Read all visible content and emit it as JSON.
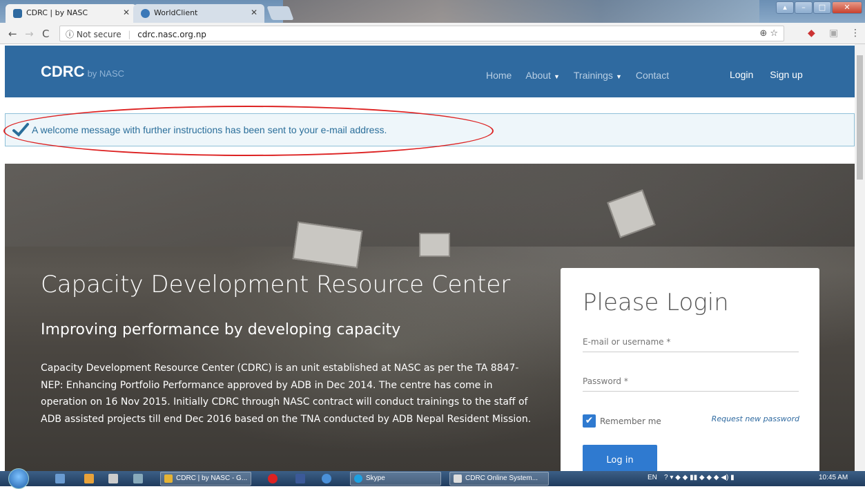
{
  "browser": {
    "tabs": [
      {
        "label": "CDRC | by NASC",
        "active": true
      },
      {
        "label": "WorldClient",
        "active": false
      }
    ],
    "security": "Not secure",
    "url": "cdrc.nasc.org.np"
  },
  "site": {
    "brand": "CDRC",
    "brand_suffix": "by NASC",
    "nav": {
      "home": "Home",
      "about": "About",
      "trainings": "Trainings",
      "contact": "Contact",
      "login": "Login",
      "signup": "Sign up"
    },
    "alert": "A welcome message with further instructions has been sent to your e-mail address.",
    "hero": {
      "title": "Capacity Development Resource Center",
      "subtitle": "Improving performance by developing capacity",
      "body": "Capacity Development Resource Center (CDRC) is an unit established at NASC as per the TA 8847-NEP: Enhancing Portfolio Performance approved by ADB in Dec 2014. The centre has come in operation on 16 Nov 2015. Initially CDRC through NASC contract will conduct trainings to the staff of ADB assisted projects till end Dec 2016 based on the TNA conducted by ADB Nepal Resident Mission."
    },
    "login": {
      "heading": "Please Login",
      "username_placeholder": "E-mail or username *",
      "password_placeholder": "Password *",
      "remember": "Remember me",
      "request_password": "Request new password",
      "button": "Log in"
    }
  },
  "taskbar": {
    "tasks": [
      {
        "label": "CDRC | by NASC - G..."
      },
      {
        "label": "Skype"
      },
      {
        "label": "CDRC Online System..."
      }
    ],
    "lang": "EN",
    "time": "10:45 AM"
  },
  "colors": {
    "header": "#2f6aa0",
    "button": "#2f7ad0",
    "alert_text": "#2a6e9a",
    "annotation": "#dd2222"
  }
}
